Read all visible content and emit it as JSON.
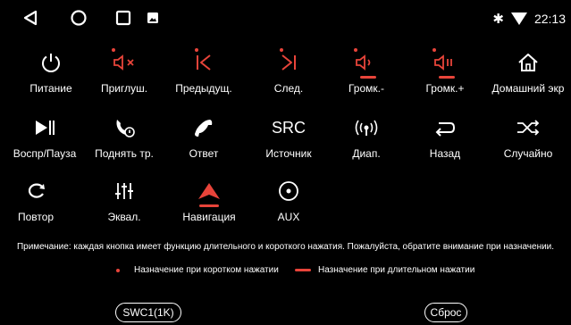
{
  "status": {
    "time": "22:13"
  },
  "colors": {
    "accent": "#e8443a",
    "background": "#000000"
  },
  "row1": [
    {
      "label": "Питание",
      "icon": "power-icon"
    },
    {
      "label": "Приглуш.",
      "icon": "mute-icon"
    },
    {
      "label": "Предыдущ.",
      "icon": "prev-track-icon"
    },
    {
      "label": "След.",
      "icon": "next-track-icon"
    },
    {
      "label": "Громк.-",
      "icon": "volume-down-icon"
    },
    {
      "label": "Громк.+",
      "icon": "volume-up-icon"
    },
    {
      "label": "Домашний экр",
      "icon": "home-icon"
    }
  ],
  "row2": [
    {
      "label": "Воспр/Пауза",
      "icon": "play-pause-icon"
    },
    {
      "label": "Поднять тр.",
      "icon": "pickup-phone-icon"
    },
    {
      "label": "Ответ",
      "icon": "answer-phone-icon"
    },
    {
      "label": "Источник",
      "icon": "src-icon",
      "icon_text": "SRC"
    },
    {
      "label": "Диап.",
      "icon": "band-icon"
    },
    {
      "label": "Назад",
      "icon": "back-icon"
    },
    {
      "label": "Случайно",
      "icon": "shuffle-icon"
    }
  ],
  "row3": [
    {
      "label": "Повтор",
      "icon": "repeat-icon"
    },
    {
      "label": "Эквал.",
      "icon": "equalizer-icon"
    },
    {
      "label": "Навигация",
      "icon": "navigation-icon"
    },
    {
      "label": "AUX",
      "icon": "aux-icon"
    }
  ],
  "note": "Примечание: каждая кнопка имеет функцию длительного и короткого нажатия. Пожалуйста, обратите внимание при назначении.",
  "legend": {
    "short": "Назначение при коротком нажатии",
    "long": "Назначение при длительном нажатии"
  },
  "buttons": {
    "swc": "SWC1(1K)",
    "reset": "Сброс"
  }
}
